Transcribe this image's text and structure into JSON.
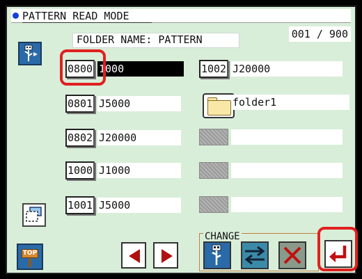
{
  "title": "PATTERN READ MODE",
  "folder": {
    "label": "FOLDER NAME:",
    "name": "PATTERN"
  },
  "page_counter": "001 / 900",
  "left_column": [
    {
      "number": "0800",
      "name": "1000",
      "selected": true
    },
    {
      "number": "0801",
      "name": "J5000",
      "selected": false
    },
    {
      "number": "0802",
      "name": "J20000",
      "selected": false
    },
    {
      "number": "1000",
      "name": "J1000",
      "selected": false
    },
    {
      "number": "1001",
      "name": "J5000",
      "selected": false
    }
  ],
  "right_column": {
    "pattern": {
      "number": "1002",
      "name": "J20000"
    },
    "folder": {
      "name": "folder1"
    },
    "empty_slots": 3
  },
  "change_group": {
    "label": "CHANGE"
  },
  "top_button": {
    "label": "TOP"
  },
  "colors": {
    "panel_background": "#d9eed9",
    "selection_highlight": "#e02020",
    "arrow_color": "#b01010",
    "title_dot": "#1440d8"
  },
  "icons": {
    "media": "usb-media-icon",
    "layer": "layers-icon",
    "top": "top-signpost-icon",
    "prev": "arrow-left-icon",
    "next": "arrow-right-icon",
    "usb": "usb-icon",
    "swap": "swap-arrows-icon",
    "delete": "delete-icon",
    "enter": "enter-icon"
  }
}
